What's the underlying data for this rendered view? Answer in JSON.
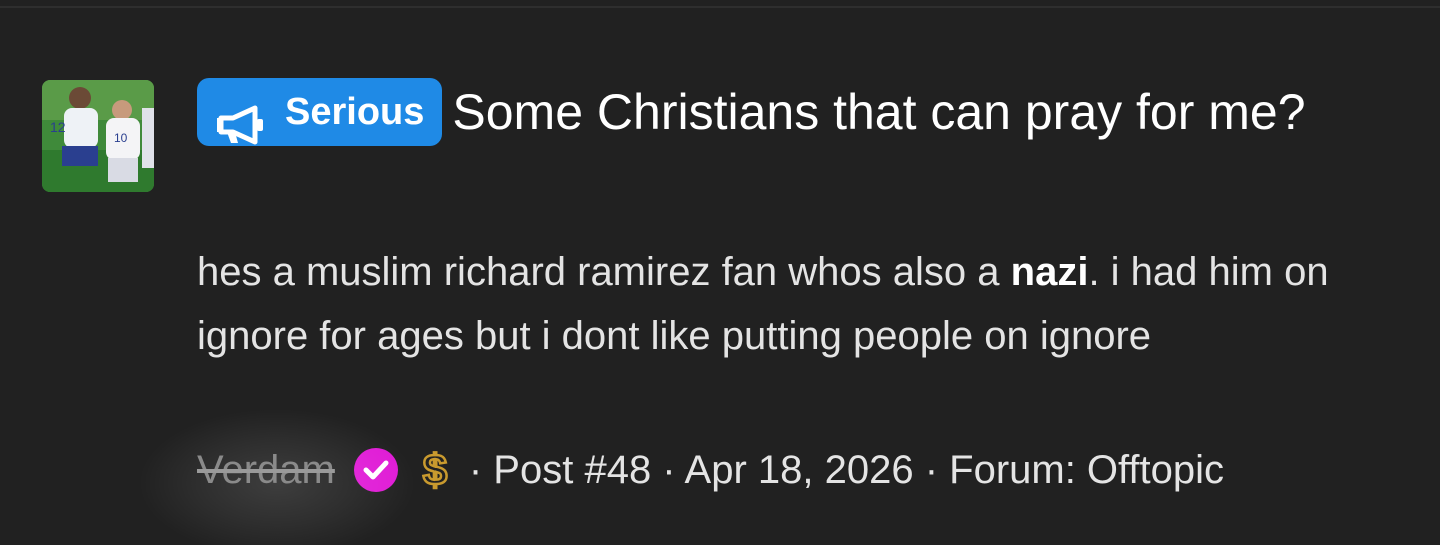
{
  "post": {
    "avatar_icon": "avatar-photo",
    "badge": {
      "label": "Serious",
      "icon": "megaphone-icon",
      "color": "#1f8ae6"
    },
    "title": "Some Christians that can pray for me?",
    "excerpt": {
      "before": "hes a muslim richard ramirez fan whos also a ",
      "bold": "nazi",
      "after": ". i had him on ignore for ages but i dont like putting people on ignore"
    },
    "meta": {
      "username": "Verdam",
      "verified_icon": "verified-check-icon",
      "verified_color": "#e01bd6",
      "donor_icon": "dollar-icon",
      "donor_color": "#c99a2e",
      "details": "· Post #48 · Apr 18, 2026 · Forum: Offtopic"
    }
  }
}
